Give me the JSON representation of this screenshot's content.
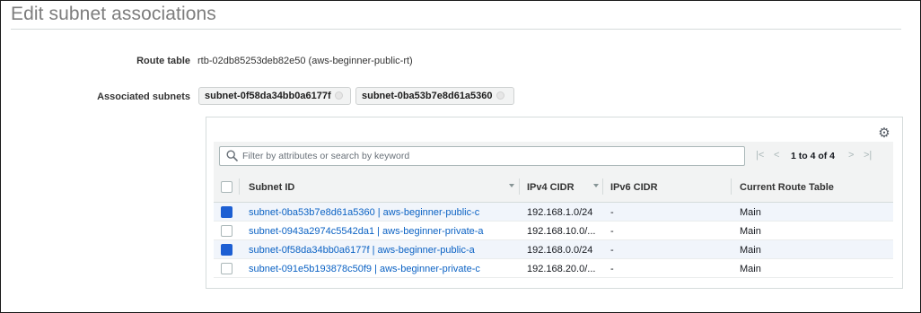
{
  "title": "Edit subnet associations",
  "route_table": {
    "label": "Route table",
    "value": "rtb-02db85253deb82e50 (aws-beginner-public-rt)"
  },
  "associated_subnets": {
    "label": "Associated subnets",
    "tags": [
      "subnet-0f58da34bb0a6177f",
      "subnet-0ba53b7e8d61a5360"
    ]
  },
  "filter": {
    "placeholder": "Filter by attributes or search by keyword",
    "value": ""
  },
  "pager": {
    "first": "|<",
    "prev": "<",
    "count": "1 to 4 of 4",
    "next": ">",
    "last": ">|"
  },
  "table": {
    "columns": [
      "Subnet ID",
      "IPv4 CIDR",
      "IPv6 CIDR",
      "Current Route Table"
    ],
    "rows": [
      {
        "subnet": "subnet-0ba53b7e8d61a5360 | aws-beginner-public-c",
        "ipv4": "192.168.1.0/24",
        "ipv6": "-",
        "route_table": "Main",
        "checked": true
      },
      {
        "subnet": "subnet-0943a2974c5542da1 | aws-beginner-private-a",
        "ipv4": "192.168.10.0/...",
        "ipv6": "-",
        "route_table": "Main",
        "checked": false
      },
      {
        "subnet": "subnet-0f58da34bb0a6177f | aws-beginner-public-a",
        "ipv4": "192.168.0.0/24",
        "ipv6": "-",
        "route_table": "Main",
        "checked": true
      },
      {
        "subnet": "subnet-091e5b193878c50f9 | aws-beginner-private-c",
        "ipv4": "192.168.20.0/...",
        "ipv6": "-",
        "route_table": "Main",
        "checked": false
      }
    ]
  },
  "icons": {
    "settings": "gear-icon",
    "search": "search-icon",
    "remove_tag": "close-icon"
  },
  "colors": {
    "link": "#0b62c4",
    "checkbox_checked": "#1d5fd3",
    "selected_row": "#f1f5fb"
  }
}
